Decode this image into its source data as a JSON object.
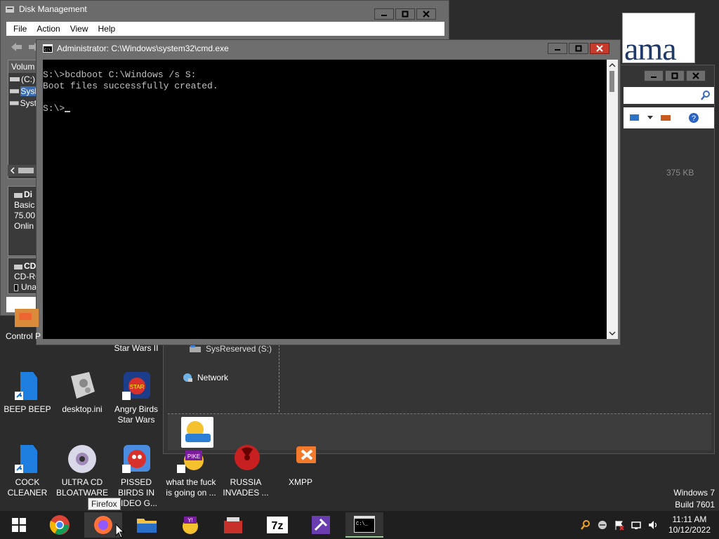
{
  "disk_management": {
    "title": "Disk Management",
    "menu": [
      "File",
      "Action",
      "View",
      "Help"
    ],
    "list_header": "Volum",
    "volumes": [
      "(C:)",
      "Sysl",
      "Syst"
    ],
    "disk_panel": {
      "name": "Di",
      "type": "Basic",
      "size": "75.00",
      "status": "Onlin"
    },
    "cd_panel": {
      "name": "CD",
      "type": "CD-RO",
      "state": "Una"
    }
  },
  "cmd": {
    "title": "Administrator: C:\\Windows\\system32\\cmd.exe",
    "lines": [
      "S:\\>bcdboot C:\\Windows /s S:",
      "Boot files successfully created.",
      "",
      "S:\\>"
    ]
  },
  "explorer": {
    "nav_sysreserved": "SysReserved (S:)",
    "nav_network": "Network",
    "size_text": "375 KB"
  },
  "logo_text": "ama",
  "desktop_icons": [
    {
      "label": "Control P",
      "name": "control-panel"
    },
    {
      "label": "Star Wars II",
      "name": "star-wars"
    },
    {
      "label": "BEEP BEEP",
      "name": "beep-beep"
    },
    {
      "label": "desktop.ini",
      "name": "desktop-ini"
    },
    {
      "label": "Angry Birds Star Wars",
      "name": "angry-birds-star-wars"
    },
    {
      "label": "COCK CLEANER",
      "name": "cock-cleaner"
    },
    {
      "label": "ULTRA CD BLOATWARE",
      "name": "ultra-cd-bloatware"
    },
    {
      "label": "PISSED BIRDS IN VIDEO G...",
      "name": "pissed-birds"
    },
    {
      "label": "what the fuck is going on ...",
      "name": "what-the-fuck"
    },
    {
      "label": "RUSSIA INVADES ...",
      "name": "russia-invades"
    },
    {
      "label": "XMPP",
      "name": "xmpp"
    }
  ],
  "tooltip": "Firefox",
  "watermark": {
    "line1": "Windows 7",
    "line2": "Build 7601"
  },
  "clock": {
    "time": "11:11 AM",
    "date": "10/12/2022"
  },
  "colors": {
    "close": "#c63b2b",
    "console_bg": "#000000",
    "console_fg": "#c0c0c0"
  }
}
